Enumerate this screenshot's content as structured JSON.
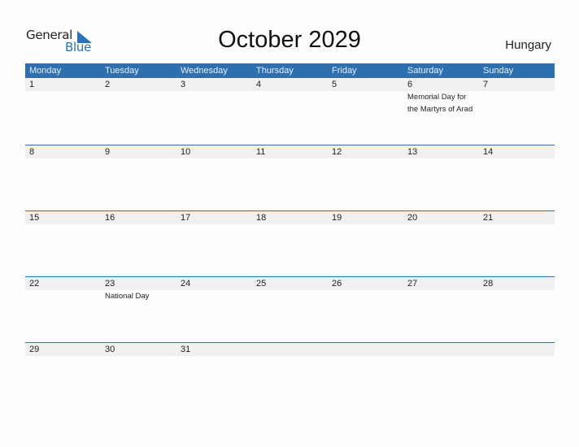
{
  "logo": {
    "line1": "General",
    "line2": "Blue"
  },
  "title": "October 2029",
  "country": "Hungary",
  "weekdays": [
    "Monday",
    "Tuesday",
    "Wednesday",
    "Thursday",
    "Friday",
    "Saturday",
    "Sunday"
  ],
  "weeks": [
    {
      "days": [
        "1",
        "2",
        "3",
        "4",
        "5",
        "6",
        "7"
      ],
      "events": [
        "",
        "",
        "",
        "",
        "",
        "Memorial Day for the Martyrs of Arad",
        ""
      ]
    },
    {
      "days": [
        "8",
        "9",
        "10",
        "11",
        "12",
        "13",
        "14"
      ],
      "events": [
        "",
        "",
        "",
        "",
        "",
        "",
        ""
      ]
    },
    {
      "days": [
        "15",
        "16",
        "17",
        "18",
        "19",
        "20",
        "21"
      ],
      "events": [
        "",
        "",
        "",
        "",
        "",
        "",
        ""
      ]
    },
    {
      "days": [
        "22",
        "23",
        "24",
        "25",
        "26",
        "27",
        "28"
      ],
      "events": [
        "",
        "National Day",
        "",
        "",
        "",
        "",
        ""
      ]
    },
    {
      "days": [
        "29",
        "30",
        "31",
        "",
        "",
        "",
        ""
      ],
      "events": [
        "",
        "",
        "",
        "",
        "",
        "",
        ""
      ]
    }
  ]
}
